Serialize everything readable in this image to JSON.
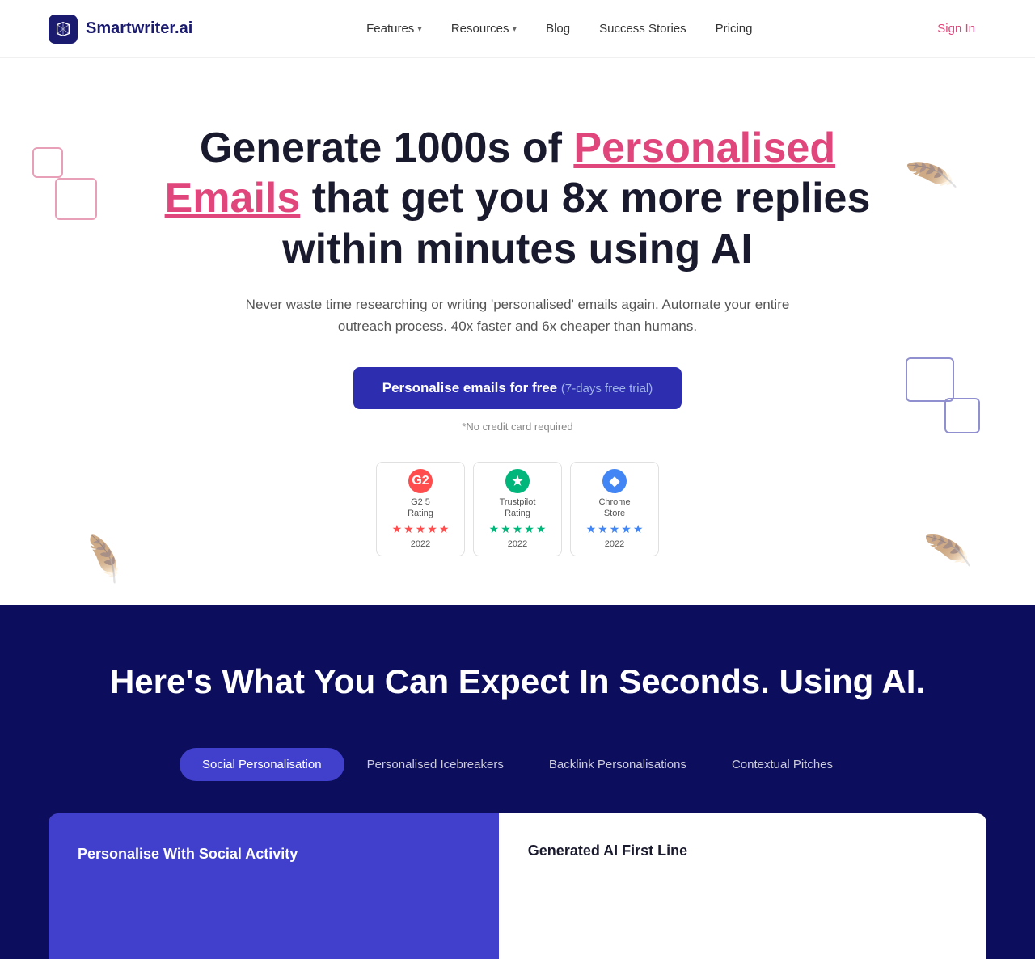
{
  "nav": {
    "logo_text": "Smartwriter.ai",
    "links": [
      {
        "label": "Features",
        "has_dropdown": true
      },
      {
        "label": "Resources",
        "has_dropdown": true
      },
      {
        "label": "Blog",
        "has_dropdown": false
      },
      {
        "label": "Success Stories",
        "has_dropdown": false
      },
      {
        "label": "Pricing",
        "has_dropdown": false
      }
    ],
    "signin_label": "Sign In"
  },
  "hero": {
    "title_start": "Generate 1000s of ",
    "title_highlight": "Personalised Emails",
    "title_end": " that get you 8x more replies within minutes using AI",
    "subtitle": "Never waste time researching or writing 'personalised' emails again. Automate your entire outreach process. 40x faster and 6x cheaper than humans.",
    "cta_main": "Personalise emails for free",
    "cta_trial": "(7-days free trial)",
    "no_cc": "*No credit card required",
    "badges": [
      {
        "icon": "G2",
        "color_class": "badge-g2",
        "label": "G2 5\nRating",
        "year": "2022",
        "star_color": "red"
      },
      {
        "icon": "★",
        "color_class": "badge-tp",
        "label": "Trustpilot\nRating",
        "year": "2022",
        "star_color": "green"
      },
      {
        "icon": "◆",
        "color_class": "badge-chrome",
        "label": "Chrome\nStore",
        "year": "2022",
        "star_color": "blue"
      }
    ]
  },
  "dark_section": {
    "title": "Here's What You Can Expect In Seconds. Using AI.",
    "tabs": [
      {
        "label": "Social Personalisation",
        "active": true
      },
      {
        "label": "Personalised Icebreakers",
        "active": false
      },
      {
        "label": "Backlink Personalisations",
        "active": false
      },
      {
        "label": "Contextual Pitches",
        "active": false
      }
    ],
    "panel_left_title": "Personalise With Social Activity",
    "panel_right_title": "Generated AI First Line"
  }
}
